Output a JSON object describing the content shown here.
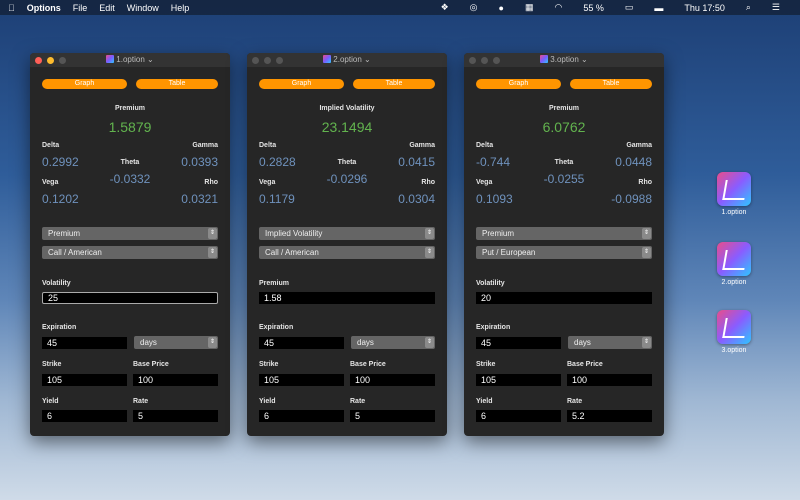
{
  "menubar": {
    "app": "Options",
    "items": [
      "File",
      "Edit",
      "Window",
      "Help"
    ],
    "battery": "55 %",
    "clock": "Thu 17:50"
  },
  "labels": {
    "graph": "Graph",
    "table": "Table",
    "delta": "Delta",
    "gamma": "Gamma",
    "theta": "Theta",
    "vega": "Vega",
    "rho": "Rho",
    "expiration": "Expiration",
    "strike": "Strike",
    "base_price": "Base Price",
    "yield": "Yield",
    "rate": "Rate"
  },
  "windows": [
    {
      "title": "1.option",
      "main_label": "Premium",
      "main_value": "1.5879",
      "delta": "0.2992",
      "gamma": "0.0393",
      "theta": "-0.0332",
      "vega": "0.1202",
      "rho": "0.0321",
      "output_select": "Premium",
      "type_select": "Call / American",
      "input_label": "Volatility",
      "input_value": "25",
      "expiration": "45",
      "expiration_unit": "days",
      "strike": "105",
      "base_price": "100",
      "yield": "6",
      "rate": "5"
    },
    {
      "title": "2.option",
      "main_label": "Implied Volatility",
      "main_value": "23.1494",
      "delta": "0.2828",
      "gamma": "0.0415",
      "theta": "-0.0296",
      "vega": "0.1179",
      "rho": "0.0304",
      "output_select": "Implied Volatility",
      "type_select": "Call / American",
      "input_label": "Premium",
      "input_value": "1.58",
      "expiration": "45",
      "expiration_unit": "days",
      "strike": "105",
      "base_price": "100",
      "yield": "6",
      "rate": "5"
    },
    {
      "title": "3.option",
      "main_label": "Premium",
      "main_value": "6.0762",
      "delta": "-0.744",
      "gamma": "0.0448",
      "theta": "-0.0255",
      "vega": "0.1093",
      "rho": "-0.0988",
      "output_select": "Premium",
      "type_select": "Put / European",
      "input_label": "Volatility",
      "input_value": "20",
      "expiration": "45",
      "expiration_unit": "days",
      "strike": "105",
      "base_price": "100",
      "yield": "6",
      "rate": "5.2"
    }
  ],
  "desktop": [
    "1.option",
    "2.option",
    "3.option"
  ],
  "colors": {
    "accent": "#ff9500",
    "value_green": "#62b34e",
    "value_blue": "#6f92bd"
  }
}
